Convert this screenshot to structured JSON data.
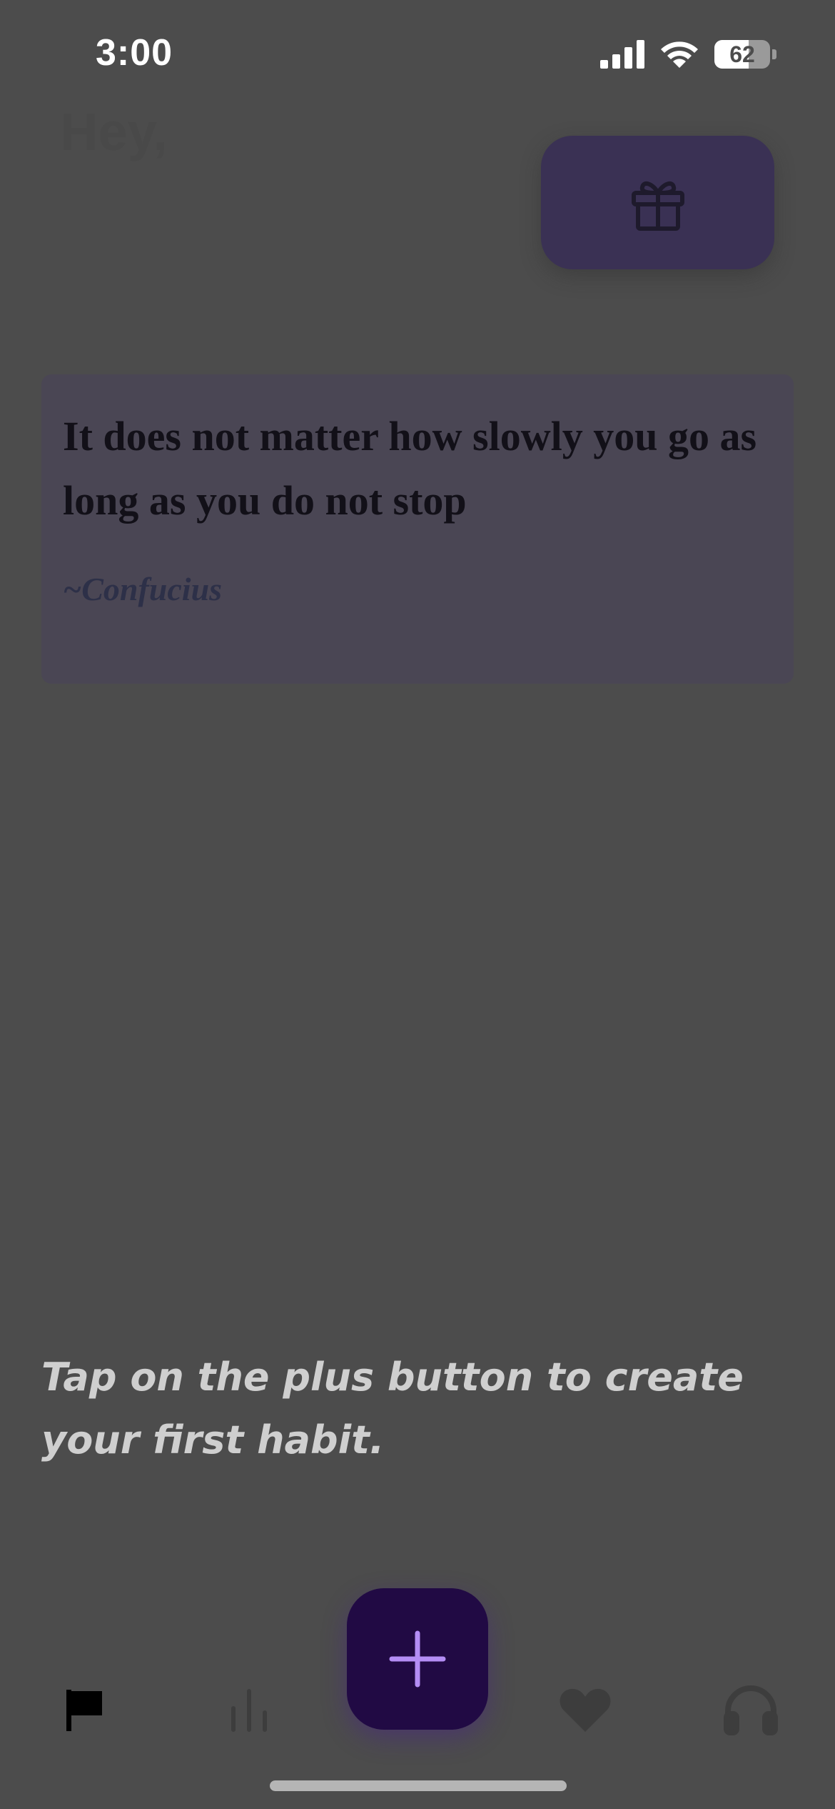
{
  "status_bar": {
    "time": "3:00",
    "battery_level": "62",
    "battery_fraction": 0.62,
    "icons": [
      "signal-icon",
      "wifi-icon",
      "battery-icon"
    ]
  },
  "header": {
    "greeting": "Hey,",
    "gift_icon": "gift-icon"
  },
  "quote": {
    "text": "It does not matter how slowly you go as long as you do not stop",
    "author": "~Confucius"
  },
  "empty_state": {
    "hint": "Tap on the plus button to create your first habit."
  },
  "bottom_nav": {
    "items": [
      {
        "icon": "flag-icon",
        "active": true
      },
      {
        "icon": "stats-icon",
        "active": false
      },
      {
        "icon": "add-icon",
        "active": false
      },
      {
        "icon": "heart-icon",
        "active": false
      },
      {
        "icon": "headphones-icon",
        "active": false
      }
    ]
  },
  "colors": {
    "background": "#4c4c4c",
    "accent_purple": "#210a44",
    "plus_color": "#b48df5",
    "gift_button": "#3a3154",
    "quote_card": "#4a4654"
  }
}
